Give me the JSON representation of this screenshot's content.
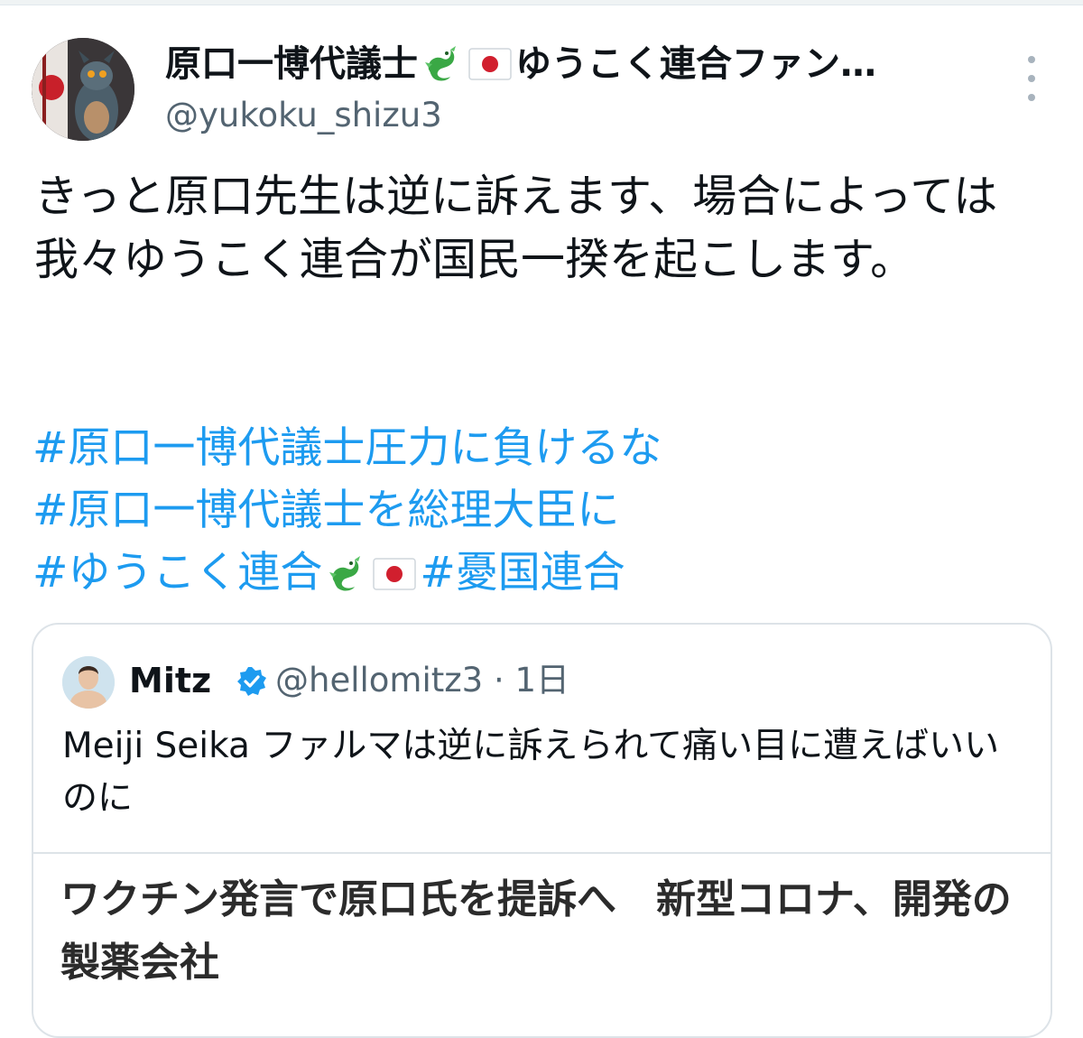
{
  "tweet": {
    "author": {
      "name_prefix": "原口一博代議士",
      "name_suffix": "ゆうこく連合ファン…",
      "handle": "@yukoku_shizu3",
      "avatar_icon": "dragon-avatar-icon"
    },
    "text": "きっと原口先生は逆に訴えます、場合によっては我々ゆうこく連合が国民一揆を起こします。",
    "hashtags": {
      "line1": "#原口一博代議士圧力に負けるな",
      "line2": "#原口一博代議士を総理大臣に",
      "line3_a": "#ゆうこく連合",
      "line3_b": "#憂国連合"
    },
    "more_icon": "more-vertical-icon"
  },
  "quote": {
    "name": "Mitz",
    "handle_time": "@hellomitz3 · 1日",
    "text": "Meiji Seika ファルマは逆に訴えられて痛い目に遭えばいいのに",
    "article_title": "ワクチン発言で原口氏を提訴へ　新型コロナ、開発の製薬会社",
    "verified_icon": "verified-badge-icon"
  },
  "colors": {
    "hashtag": "#1d9bf0",
    "handle": "#536471",
    "verified": "#1d9bf0",
    "border": "#dde3e8"
  }
}
